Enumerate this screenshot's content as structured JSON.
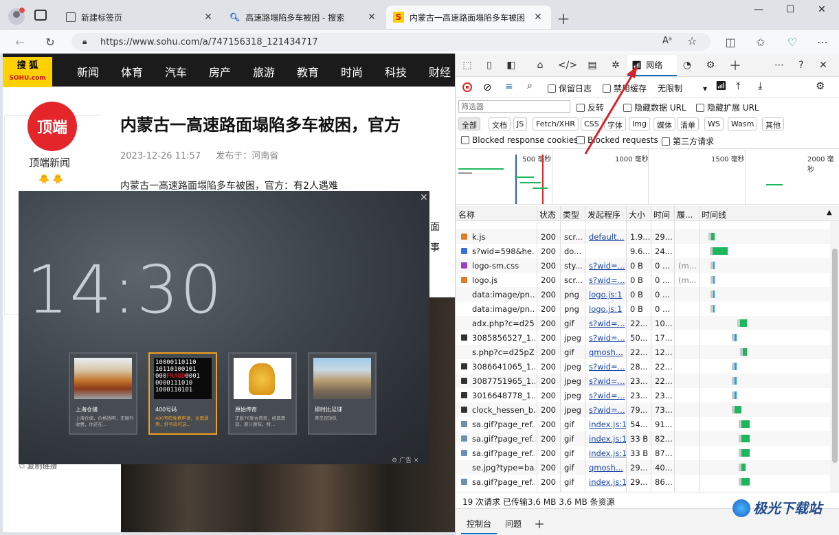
{
  "tabs": [
    {
      "title": "新建标签页",
      "icon": "new-tab-page-icon"
    },
    {
      "title": "高速路塌陷多车被困 - 搜索",
      "icon": "search-icon"
    },
    {
      "title": "内蒙古一高速路面塌陷多车被困",
      "icon": "sohu-favicon"
    }
  ],
  "address": {
    "url": "https://www.sohu.com/a/747156318_121434717"
  },
  "sohu": {
    "logo_cn": "搜 狐",
    "logo_en": "SOHU.com",
    "nav": [
      "新闻",
      "体育",
      "汽车",
      "房产",
      "旅游",
      "教育",
      "时尚",
      "科技",
      "财经"
    ],
    "author_avatar": "顶端",
    "author_name": "顶端新闻",
    "author_emoji": "🐥 🐥",
    "article_title": "内蒙古一高速路面塌陷多车被困，官方",
    "date": "2023-12-26 11:57",
    "published_from": "发布于：河南省",
    "first_para": "内蒙古一高速路面塌陷多车被困，官方：有2人遇难",
    "side_text_1": "面",
    "side_text_2": "事",
    "bottom_left_text": "复制链接"
  },
  "popup": {
    "clock": "14:30",
    "cards": [
      {
        "title": "上海仓储",
        "desc": "上海仓储，价格透明，无额外收费，你还在..."
      },
      {
        "title": "400号码",
        "desc": "400号码免费申请，全国通用，好号码可选..."
      },
      {
        "title": "原始传奇",
        "desc": "正版76复古传奇，经典再现，原汁原味，特..."
      },
      {
        "title": "即时比足球",
        "desc": "青岛足球队"
      }
    ],
    "ad_label": "广告",
    "close": "✕"
  },
  "devtools": {
    "network_tab": "网络",
    "preserve_log": "保留日志",
    "disable_cache": "禁用缓存",
    "throttle": "无限制",
    "filter_placeholder": "筛选器",
    "invert": "反转",
    "hide_data_url": "隐藏数据 URL",
    "hide_ext_url": "隐藏扩展 URL",
    "types": [
      "全部",
      "文档",
      "JS",
      "Fetch/XHR",
      "CSS",
      "字体",
      "Img",
      "媒体",
      "清单",
      "WS",
      "Wasm",
      "其他"
    ],
    "blocked_cookies": "Blocked response cookies",
    "blocked_requests": "Blocked requests",
    "third_party": "第三方请求",
    "overview_ticks": [
      "500 毫秒",
      "1000 毫秒",
      "1500 毫秒",
      "2000 毫秒"
    ],
    "columns": [
      "名称",
      "状态",
      "类型",
      "发起程序",
      "大小",
      "时间",
      "履...",
      "时间线"
    ],
    "rows": [
      {
        "name": "k.js",
        "status": "200",
        "type": "scr...",
        "init": "default...",
        "size": "1.9...",
        "time": "29...",
        "extra": "",
        "icon": "js",
        "bar": [
          8,
          5
        ]
      },
      {
        "name": "s?wid=598&he...",
        "status": "200",
        "type": "do...",
        "init": "",
        "size": "9.6...",
        "time": "24...",
        "extra": "",
        "icon": "doc",
        "bar": [
          10,
          22
        ]
      },
      {
        "name": "logo-sm.css",
        "status": "200",
        "type": "sty...",
        "init": "s?wid=...",
        "size": "0 B",
        "time": "0 ...",
        "extra": "(m...",
        "icon": "css",
        "bar": [
          11,
          2
        ]
      },
      {
        "name": "logo.js",
        "status": "200",
        "type": "scr...",
        "init": "s?wid=...",
        "size": "0 B",
        "time": "0 ...",
        "extra": "(m...",
        "icon": "js",
        "bar": [
          11,
          2
        ]
      },
      {
        "name": "data:image/pn...",
        "status": "200",
        "type": "png",
        "init": "logo.js:1",
        "size": "0 B",
        "time": "0 ...",
        "extra": "",
        "icon": "none",
        "bar": [
          11,
          2
        ]
      },
      {
        "name": "data:image/pn...",
        "status": "200",
        "type": "png",
        "init": "logo.js:1",
        "size": "0 B",
        "time": "0 ...",
        "extra": "",
        "icon": "none",
        "bar": [
          11,
          2
        ]
      },
      {
        "name": "adx.php?c=d25...",
        "status": "200",
        "type": "gif",
        "init": "s?wid=...",
        "size": "22...",
        "time": "10...",
        "extra": "",
        "icon": "none",
        "bar": [
          50,
          10
        ]
      },
      {
        "name": "3085856527_1...",
        "status": "200",
        "type": "jpeg",
        "init": "s?wid=...",
        "size": "50...",
        "time": "17...",
        "extra": "",
        "icon": "img",
        "bar": [
          42,
          3
        ]
      },
      {
        "name": "s.php?c=d25pZ...",
        "status": "200",
        "type": "gif",
        "init": "qmosh...",
        "size": "22...",
        "time": "12...",
        "extra": "",
        "icon": "none",
        "bar": [
          54,
          6
        ]
      },
      {
        "name": "3086641065_1...",
        "status": "200",
        "type": "jpeg",
        "init": "s?wid=...",
        "size": "28...",
        "time": "22...",
        "extra": "",
        "icon": "img",
        "bar": [
          42,
          3
        ]
      },
      {
        "name": "3087751965_1...",
        "status": "200",
        "type": "jpeg",
        "init": "s?wid=...",
        "size": "23...",
        "time": "22...",
        "extra": "",
        "icon": "img",
        "bar": [
          42,
          3
        ]
      },
      {
        "name": "3016648778_1...",
        "status": "200",
        "type": "jpeg",
        "init": "s?wid=...",
        "size": "23...",
        "time": "23...",
        "extra": "",
        "icon": "img",
        "bar": [
          42,
          3
        ]
      },
      {
        "name": "clock_hessen_b...",
        "status": "200",
        "type": "jpeg",
        "init": "s?wid=...",
        "size": "79...",
        "time": "73...",
        "extra": "",
        "icon": "img",
        "bar": [
          42,
          10
        ]
      },
      {
        "name": "sa.gif?page_ref...",
        "status": "200",
        "type": "gif",
        "init": "index.js:1",
        "size": "54...",
        "time": "91...",
        "extra": "",
        "icon": "gif",
        "bar": [
          52,
          12
        ]
      },
      {
        "name": "sa.gif?page_ref...",
        "status": "200",
        "type": "gif",
        "init": "index.js:1",
        "size": "33 B",
        "time": "82...",
        "extra": "",
        "icon": "gif",
        "bar": [
          52,
          12
        ]
      },
      {
        "name": "sa.gif?page_ref...",
        "status": "200",
        "type": "gif",
        "init": "index.js:1",
        "size": "33 B",
        "time": "87...",
        "extra": "",
        "icon": "gif",
        "bar": [
          52,
          12
        ]
      },
      {
        "name": "se.jpg?type=ba...",
        "status": "200",
        "type": "gif",
        "init": "qmosh...",
        "size": "29...",
        "time": "40...",
        "extra": "",
        "icon": "none",
        "bar": [
          52,
          6
        ]
      },
      {
        "name": "sa.gif?page_ref...",
        "status": "200",
        "type": "gif",
        "init": "index.js:1",
        "size": "29...",
        "time": "86...",
        "extra": "",
        "icon": "gif",
        "bar": [
          52,
          12
        ]
      }
    ],
    "summary": "19 次请求  已传输3.6 MB  3.6 MB 条资源",
    "drawer_tabs": [
      "控制台",
      "问题"
    ]
  },
  "watermark": "极光下载站",
  "colors": {
    "accent": "#0f6cbd",
    "bar_green": "#1bb75b",
    "sohu_yellow": "#ffd100",
    "popup_select": "#f0a020",
    "arrow": "#d8232a"
  }
}
